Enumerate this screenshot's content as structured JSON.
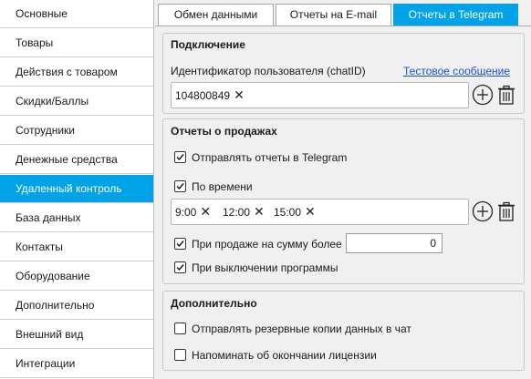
{
  "sidebar": {
    "items": [
      {
        "label": "Основные",
        "active": false
      },
      {
        "label": "Товары",
        "active": false
      },
      {
        "label": "Действия с товаром",
        "active": false
      },
      {
        "label": "Скидки/Баллы",
        "active": false
      },
      {
        "label": "Сотрудники",
        "active": false
      },
      {
        "label": "Денежные средства",
        "active": false
      },
      {
        "label": "Удаленный контроль",
        "active": true
      },
      {
        "label": "База данных",
        "active": false
      },
      {
        "label": "Контакты",
        "active": false
      },
      {
        "label": "Оборудование",
        "active": false
      },
      {
        "label": "Дополнительно",
        "active": false
      },
      {
        "label": "Внешний вид",
        "active": false
      },
      {
        "label": "Интеграции",
        "active": false
      }
    ]
  },
  "tabs": [
    {
      "label": "Обмен данными",
      "active": false
    },
    {
      "label": "Отчеты на E-mail",
      "active": false
    },
    {
      "label": "Отчеты в Telegram",
      "active": true
    }
  ],
  "connection": {
    "title": "Подключение",
    "user_id_label": "Идентификатор пользователя (chatID)",
    "test_link": "Тестовое сообщение",
    "chat_ids": [
      "104800849"
    ]
  },
  "sales_reports": {
    "title": "Отчеты о продажах",
    "send_reports": {
      "label": "Отправлять отчеты в Telegram",
      "checked": true
    },
    "by_time": {
      "label": "По времени",
      "checked": true
    },
    "times": [
      "9:00",
      "12:00",
      "15:00"
    ],
    "on_sale_amount": {
      "label": "При продаже на сумму более",
      "checked": true,
      "value": "0"
    },
    "on_shutdown": {
      "label": "При выключении программы",
      "checked": true
    }
  },
  "additional": {
    "title": "Дополнительно",
    "send_backups": {
      "label": "Отправлять резервные копии данных в чат",
      "checked": false
    },
    "license_reminder": {
      "label": "Напоминать об окончании лицензии",
      "checked": false
    }
  },
  "colors": {
    "accent": "#00a2e8",
    "link": "#1f4fd8"
  }
}
